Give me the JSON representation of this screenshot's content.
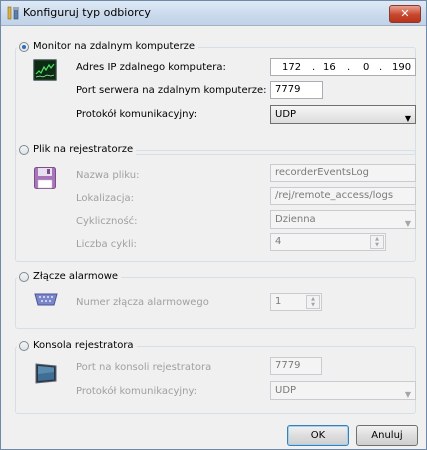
{
  "dialog": {
    "title": "Konfiguruj typ odbiorcy",
    "close_label": "✕"
  },
  "monitor": {
    "legend": "Monitor na zdalnym komputerze",
    "selected": true,
    "ip_label": "Adres IP zdalnego komputera:",
    "ip": [
      "172",
      "16",
      "0",
      "190"
    ],
    "port_label": "Port serwera na zdalnym komputerze:",
    "port": "7779",
    "protocol_label": "Protokół komunikacyjny:",
    "protocol": "UDP"
  },
  "file": {
    "legend": "Plik na rejestratorze",
    "selected": false,
    "name_label": "Nazwa pliku:",
    "name": "recorderEventsLog",
    "location_label": "Lokalizacja:",
    "location": "/rej/remote_access/logs",
    "cycle_label": "Cykliczność:",
    "cycle": "Dzienna",
    "cycles_label": "Liczba cykli:",
    "cycles": "4"
  },
  "alarm": {
    "legend": "Złącze alarmowe",
    "selected": false,
    "port_label": "Numer złącza alarmowego",
    "port": "1"
  },
  "console": {
    "legend": "Konsola rejestratora",
    "selected": false,
    "port_label": "Port na konsoli rejestratora",
    "port": "7779",
    "protocol_label": "Protokół komunikacyjny:",
    "protocol": "UDP"
  },
  "buttons": {
    "ok": "OK",
    "cancel": "Anuluj"
  },
  "icons": {
    "title": "tool-icon",
    "monitor": "monitor-graph-icon",
    "file": "floppy-disk-icon",
    "alarm": "serial-port-icon",
    "console": "screen-icon"
  }
}
